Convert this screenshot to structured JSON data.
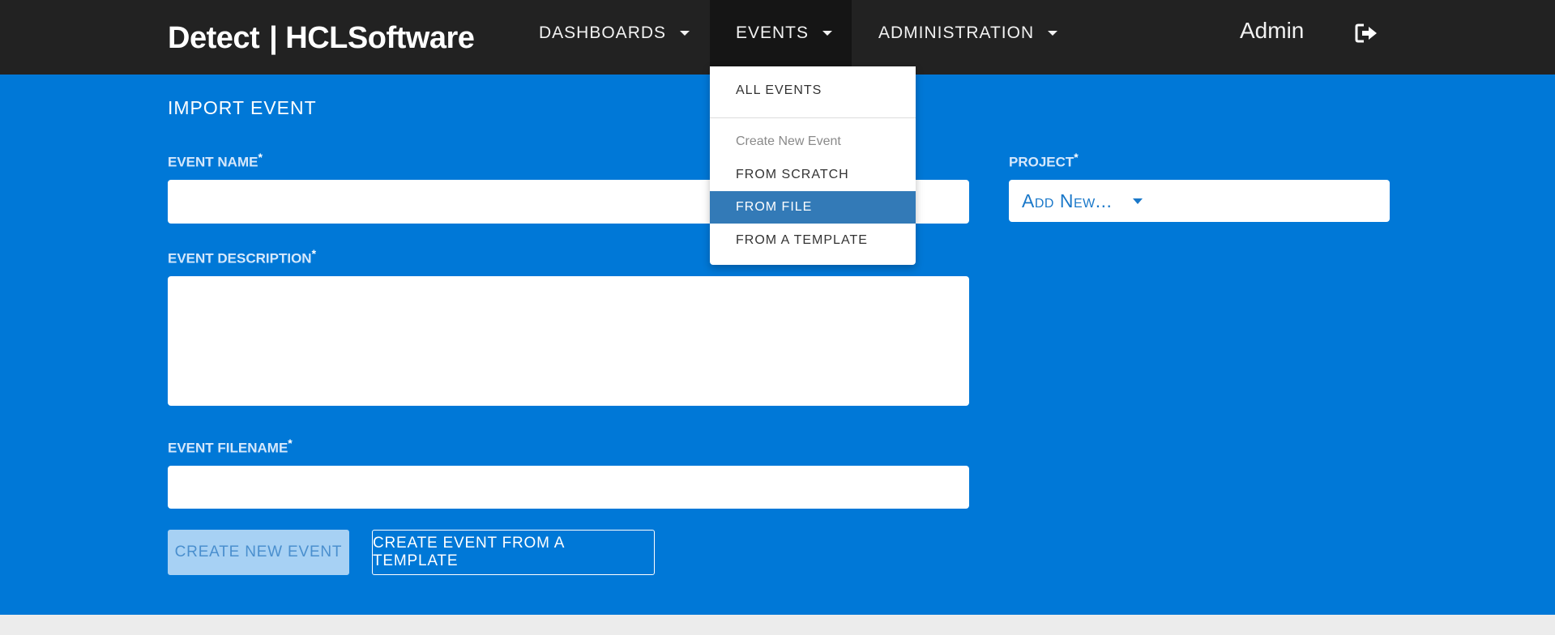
{
  "brand": {
    "left": "Detect",
    "separator": "|",
    "right": "HCLSoftware"
  },
  "nav": {
    "dashboards": "DASHBOARDS",
    "events": "EVENTS",
    "administration": "ADMINISTRATION",
    "user": "Admin"
  },
  "events_menu": {
    "all_events": "ALL EVENTS",
    "header": "Create New Event",
    "from_scratch": "FROM SCRATCH",
    "from_file": "FROM FILE",
    "from_template": "FROM A TEMPLATE"
  },
  "page": {
    "title": "IMPORT EVENT"
  },
  "form": {
    "event_name_label": "EVENT NAME",
    "event_description_label": "EVENT DESCRIPTION",
    "event_filename_label": "EVENT FILENAME",
    "project_label": "PROJECT",
    "required_marker": "*",
    "event_name_value": "",
    "event_description_value": "",
    "event_filename_value": "",
    "project_value": "Add New..."
  },
  "buttons": {
    "create_new_event": "CREATE NEW EVENT",
    "create_from_template": "CREATE EVENT FROM A TEMPLATE"
  },
  "icons": {
    "logout": "logout-icon",
    "dropdown_caret": "caret-down-icon"
  },
  "colors": {
    "navbar_bg": "#222222",
    "panel_bg": "#0078d7",
    "menu_active": "#337ab7",
    "disabled_button_bg": "#a7d1f4"
  }
}
